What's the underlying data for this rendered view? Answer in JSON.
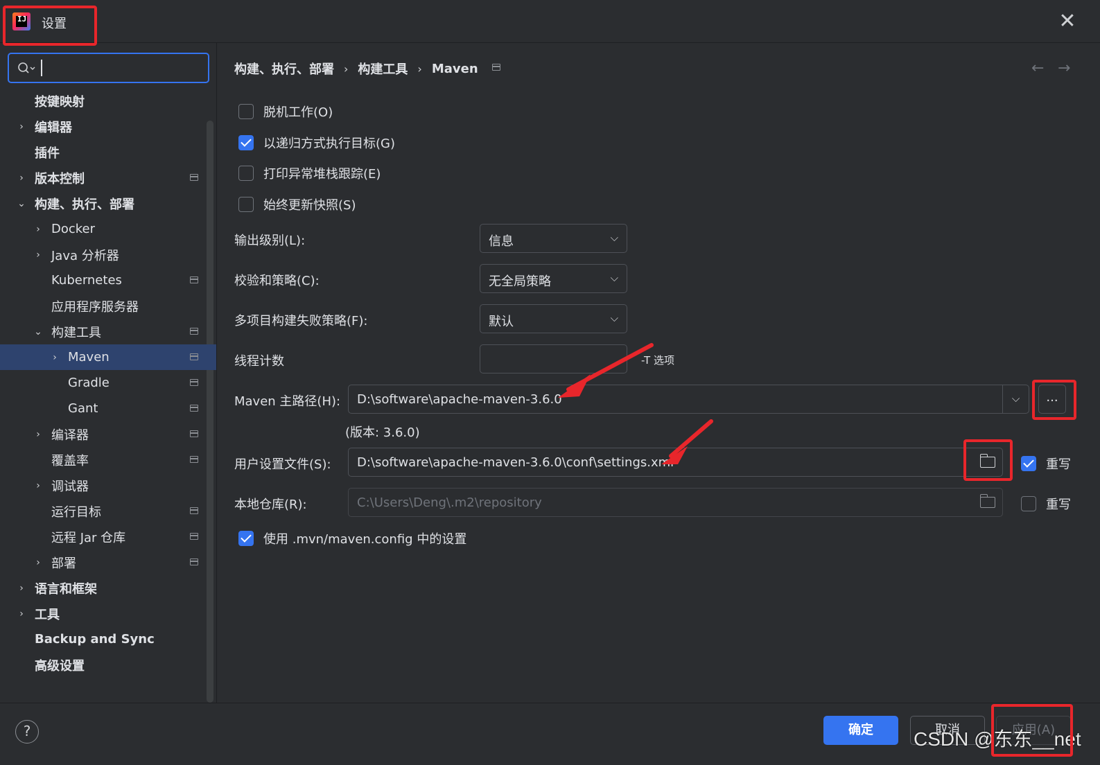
{
  "window": {
    "title": "设置",
    "close_glyph": "✕"
  },
  "search": {
    "placeholder": ""
  },
  "sidebar": {
    "items": [
      {
        "label": "按键映射"
      },
      {
        "label": "编辑器"
      },
      {
        "label": "插件"
      },
      {
        "label": "版本控制"
      },
      {
        "label": "构建、执行、部署"
      },
      {
        "label": "Docker"
      },
      {
        "label": "Java 分析器"
      },
      {
        "label": "Kubernetes"
      },
      {
        "label": "应用程序服务器"
      },
      {
        "label": "构建工具"
      },
      {
        "label": "Maven"
      },
      {
        "label": "Gradle"
      },
      {
        "label": "Gant"
      },
      {
        "label": "编译器"
      },
      {
        "label": "覆盖率"
      },
      {
        "label": "调试器"
      },
      {
        "label": "运行目标"
      },
      {
        "label": "远程 Jar 仓库"
      },
      {
        "label": "部署"
      },
      {
        "label": "语言和框架"
      },
      {
        "label": "工具"
      },
      {
        "label": "Backup and Sync"
      },
      {
        "label": "高级设置"
      }
    ]
  },
  "breadcrumb": [
    "构建、执行、部署",
    "构建工具",
    "Maven"
  ],
  "options": {
    "offline": {
      "label": "脱机工作(O)",
      "checked": false
    },
    "recursive": {
      "label": "以递归方式执行目标(G)",
      "checked": true
    },
    "stacktrace": {
      "label": "打印异常堆栈跟踪(E)",
      "checked": false
    },
    "snapshots": {
      "label": "始终更新快照(S)",
      "checked": false
    },
    "mvn_config": {
      "label": "使用 .mvn/maven.config 中的设置",
      "checked": true
    }
  },
  "fields": {
    "output_level": {
      "label": "输出级别(L):",
      "value": "信息"
    },
    "checksum": {
      "label": "校验和策略(C):",
      "value": "无全局策略"
    },
    "multiproject": {
      "label": "多项目构建失败策略(F):",
      "value": "默认"
    },
    "threads": {
      "label": "线程计数",
      "value": "",
      "hint": "-T 选项"
    },
    "maven_home": {
      "label": "Maven 主路径(H):",
      "value": "D:\\software\\apache-maven-3.6.0",
      "version": "(版本: 3.6.0)",
      "browse": "..."
    },
    "user_settings": {
      "label": "用户设置文件(S):",
      "value": "D:\\software\\apache-maven-3.6.0\\conf\\settings.xml",
      "override_label": "重写",
      "override": true
    },
    "local_repo": {
      "label": "本地仓库(R):",
      "value": "C:\\Users\\Deng\\.m2\\repository",
      "override_label": "重写",
      "override": false
    }
  },
  "buttons": {
    "ok": "确定",
    "cancel": "取消",
    "apply": "应用(A)",
    "help": "?"
  },
  "watermark": "CSDN @东东__net",
  "colors": {
    "accent": "#3574f0",
    "annotation": "#e8262b",
    "background": "#2b2d30",
    "selection": "#2e436e"
  }
}
